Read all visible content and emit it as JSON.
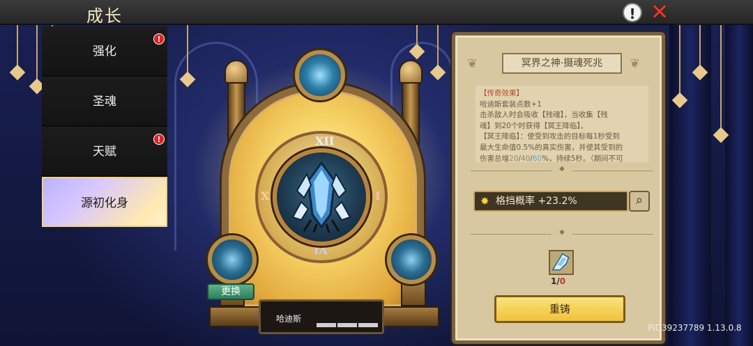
{
  "header": {
    "title": "成长",
    "help_icon": "exclamation-icon",
    "close_icon": "close-x-icon"
  },
  "tabs": [
    {
      "label": "强化",
      "badge": "!"
    },
    {
      "label": "圣魂",
      "badge": ""
    },
    {
      "label": "天赋",
      "badge": "!"
    },
    {
      "label": "源初化身",
      "badge": ""
    }
  ],
  "active_tab": "源初化身",
  "avatar": {
    "swap_label": "更换",
    "hero_name": "哈迪斯",
    "numerals": {
      "top": "XII",
      "left": "X",
      "right": "I",
      "bottom": "IA"
    }
  },
  "detail": {
    "title": "冥界之神·摄魂死兆",
    "description": {
      "line1": "【传奇效果】",
      "line2": "哈迪斯套装点数+1",
      "line3": "击杀敌人时会吸收【残魂】，当收集【残",
      "line4": "魂】到20个时获得【冥王降临】。",
      "line5": "【冥王降临】：使受到攻击的目标每1秒受到",
      "line6": "最大生命值0.5%的真实伤害，并使其受到的",
      "line7_a": "伤害总增",
      "line7_t1": "20",
      "line7_s1": "/",
      "line7_t2": "40",
      "line7_s2": "/",
      "line7_t3": "60",
      "line7_b": "%，持续5秒。（期间不可"
    },
    "stat": {
      "label": "格挡概率 +23.2%",
      "icon": "star-burst-icon"
    },
    "zoom_icon": "magnifier-icon",
    "item": {
      "icon": "crystal-shard-icon",
      "count_have": "1",
      "count_sep": "/",
      "count_need": "0"
    },
    "reforge_label": "重铸"
  },
  "footer": {
    "pid": "PID39237789 1.13.0.8"
  },
  "colors": {
    "accent_gold": "#f1c23b",
    "panel_bg": "#d8c8a2",
    "alert_red": "#dd2222"
  }
}
